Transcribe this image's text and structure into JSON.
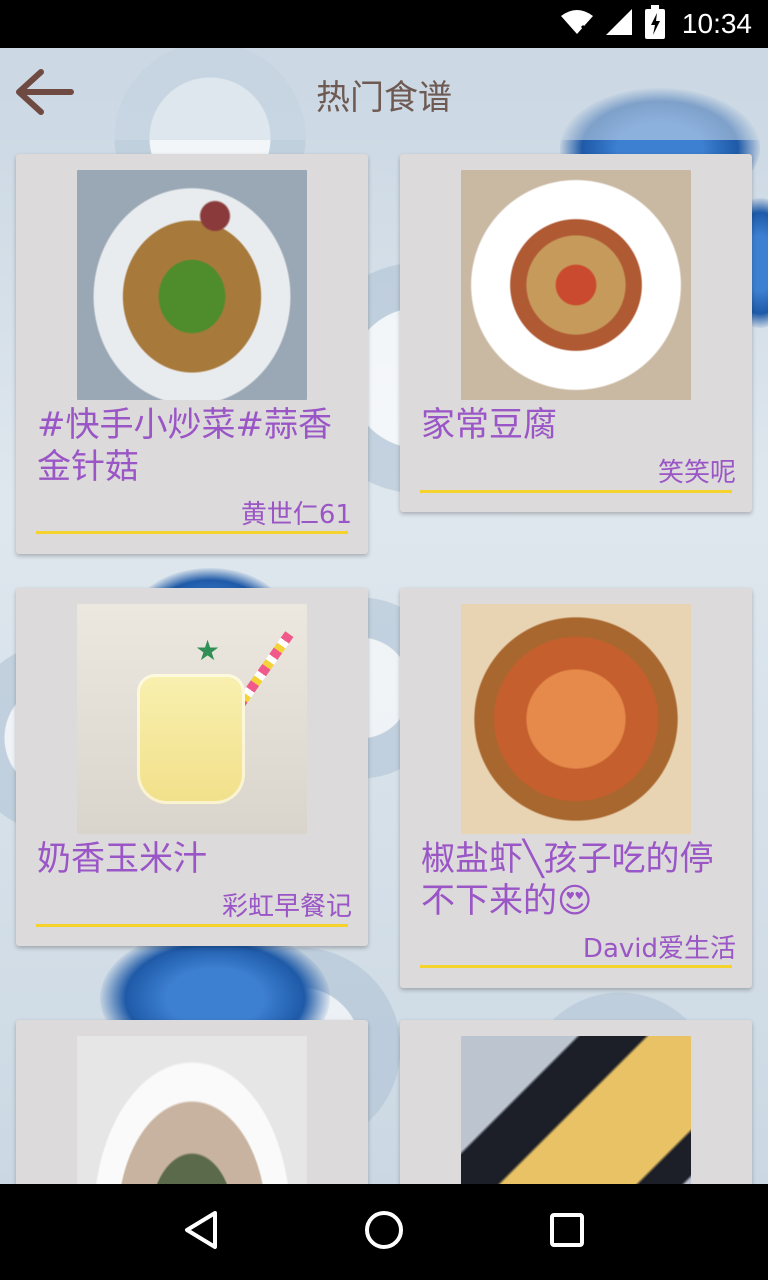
{
  "status_bar": {
    "time": "10:34"
  },
  "toolbar": {
    "title": "热门食谱"
  },
  "recipes": [
    {
      "title": "#快手小炒菜#蒜香金针菇",
      "author": "黄世仁61"
    },
    {
      "title": "家常豆腐",
      "author": "笑笑呢"
    },
    {
      "title": "奶香玉米汁",
      "author": "彩虹早餐记"
    },
    {
      "title": "椒盐虾╲孩子吃的停不下来的😍",
      "author": "David爱生活"
    },
    {
      "title": "",
      "author": ""
    },
    {
      "title": "",
      "author": ""
    }
  ],
  "colors": {
    "accent_text": "#9a55c6",
    "underline": "#f3d32c",
    "card_bg": "#dcdada",
    "title_color": "#6e5a52"
  },
  "icons": {
    "back": "arrow-left-icon",
    "wifi": "wifi-icon",
    "signal": "signal-icon",
    "battery": "battery-icon",
    "nav_back": "triangle-back-icon",
    "nav_home": "circle-home-icon",
    "nav_recents": "square-recents-icon"
  }
}
